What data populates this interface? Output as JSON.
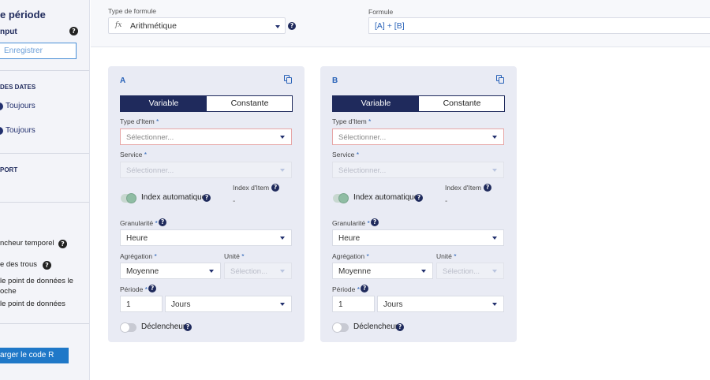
{
  "sidebar": {
    "title": "e période",
    "input_label": "nput",
    "save_button": "Enregistrer",
    "dates_section": "DES DATES",
    "radio1": "Toujours",
    "radio2": "Toujours",
    "report_section": "PORT",
    "trigger_text": "ncheur temporel",
    "holes_text": "e des trous",
    "point_text1": "le point de données le",
    "point_text2": "oche",
    "point_text3": "le point de données",
    "r_button": "arger le code R"
  },
  "topbar": {
    "formula_type_label": "Type de formule",
    "formula_type_value": "Arithmétique",
    "fx_icon": "fx",
    "formula_label": "Formule",
    "formula_value": "[A] + [B]"
  },
  "labels": {
    "variable": "Variable",
    "constante": "Constante",
    "item_type": "Type d'Item",
    "service": "Service",
    "auto_index": "Index automatique",
    "item_index": "Index d'Item",
    "granularity": "Granularité",
    "aggregation": "Agrégation",
    "unit": "Unité",
    "period": "Période",
    "trigger": "Déclencheur",
    "required": "*",
    "help": "?"
  },
  "cards": [
    {
      "letter": "A",
      "item_type_placeholder": "Sélectionner...",
      "service_placeholder": "Sélectionner...",
      "index_value": "-",
      "granularity_value": "Heure",
      "aggregation_value": "Moyenne",
      "unit_placeholder": "Sélection...",
      "period_number": "1",
      "period_unit": "Jours"
    },
    {
      "letter": "B",
      "item_type_placeholder": "Sélectionner...",
      "service_placeholder": "Sélectionner...",
      "index_value": "-",
      "granularity_value": "Heure",
      "aggregation_value": "Moyenne",
      "unit_placeholder": "Sélection...",
      "period_number": "1",
      "period_unit": "Jours"
    }
  ],
  "colors": {
    "accent": "#1f2a5c",
    "link": "#2a63b8",
    "button": "#1f78c8",
    "card_bg": "#e9ebf4"
  }
}
